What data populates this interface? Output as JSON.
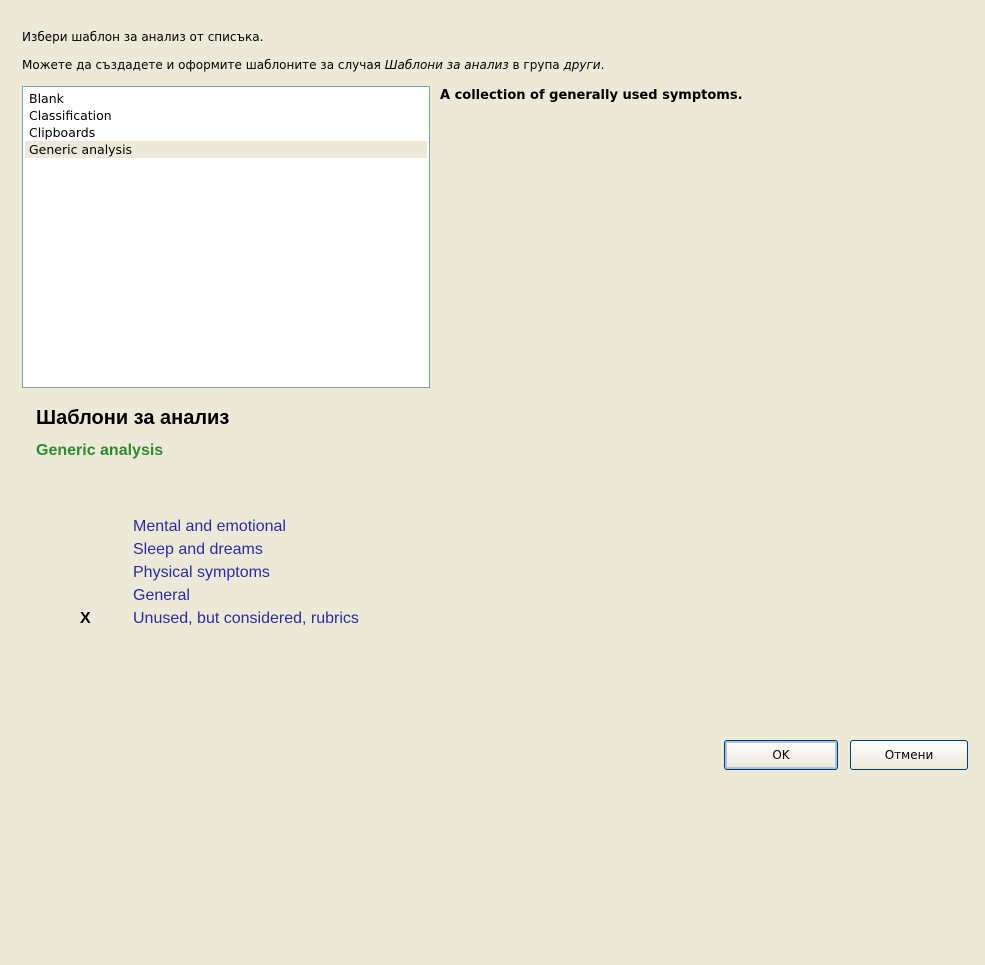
{
  "dialog": {
    "instruction_1": "Избери шаблон за анализ от списъка.",
    "instruction_2_prefix": "Можете да създадете и оформите шаблоните за случая ",
    "instruction_2_italic_1": "Шаблони за анализ",
    "instruction_2_middle": " в група ",
    "instruction_2_italic_2": "други",
    "instruction_2_suffix": "."
  },
  "template_list": {
    "items": [
      {
        "label": "Blank"
      },
      {
        "label": "Classification"
      },
      {
        "label": "Clipboards"
      },
      {
        "label": "Generic analysis"
      }
    ],
    "selected_index": 3
  },
  "description": "A collection of generally used symptoms.",
  "preview": {
    "title": "Шаблони за анализ",
    "subtitle": "Generic analysis",
    "sections": [
      {
        "mark": "",
        "label": "Mental and emotional"
      },
      {
        "mark": "",
        "label": "Sleep and dreams"
      },
      {
        "mark": "",
        "label": "Physical symptoms"
      },
      {
        "mark": "",
        "label": "General"
      },
      {
        "mark": "X",
        "label": "Unused, but considered, rubrics"
      }
    ]
  },
  "buttons": {
    "ok_label": "OK",
    "cancel_label": "Отмени"
  },
  "colors": {
    "background": "#ece9d8",
    "subtitle": "#2e8b2e",
    "section_text": "#2b2b9e",
    "list_border": "#7f9db9"
  }
}
